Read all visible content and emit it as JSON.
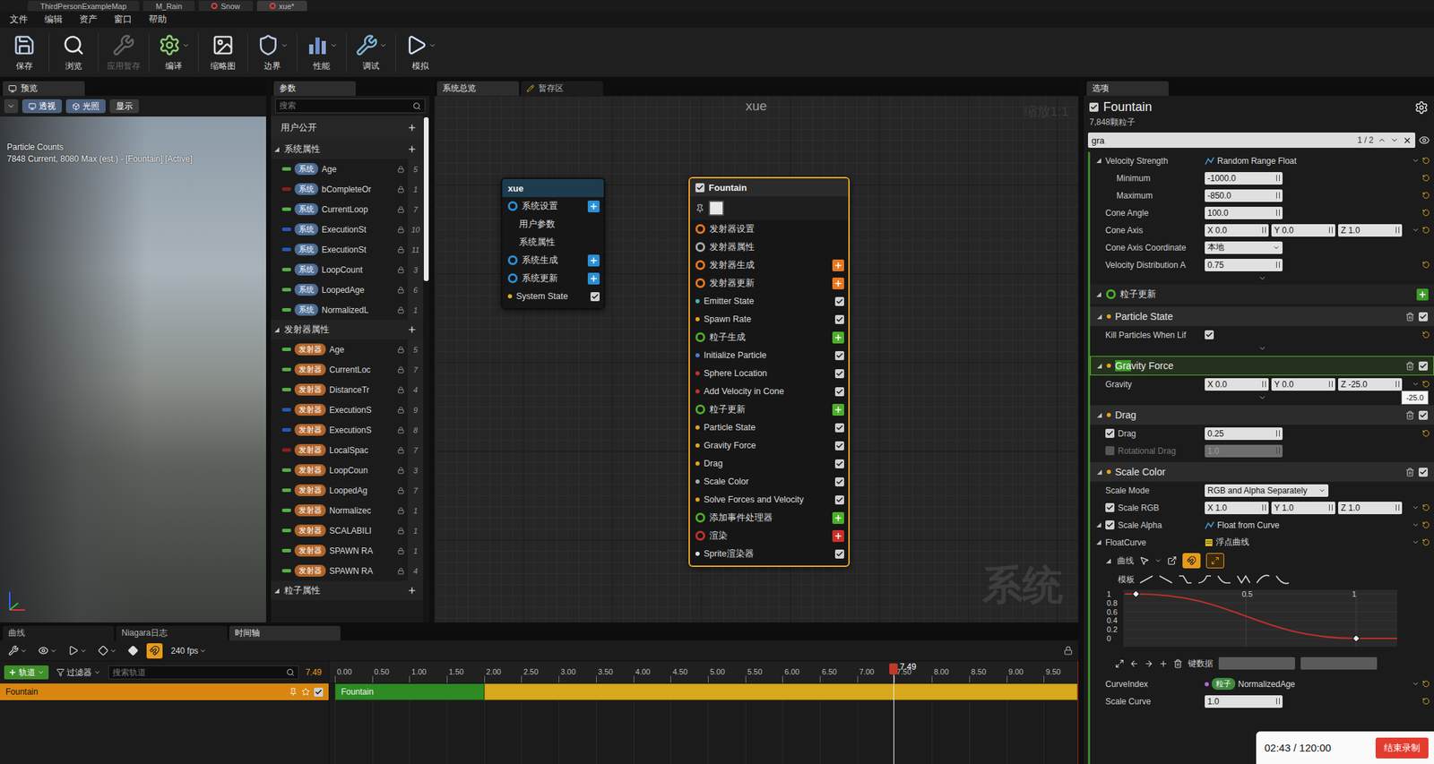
{
  "editor_tabs": [
    {
      "label": "ThirdPersonExampleMap",
      "selected": false
    },
    {
      "label": "M_Rain",
      "selected": false
    },
    {
      "label": "Snow",
      "selected": false
    },
    {
      "label": "xue*",
      "selected": true
    }
  ],
  "menu": [
    "文件",
    "编辑",
    "资产",
    "窗口",
    "帮助"
  ],
  "toolbar": [
    {
      "label": "保存",
      "disabled": false,
      "dropdown": false
    },
    {
      "label": "浏览",
      "disabled": false,
      "dropdown": false
    },
    {
      "label": "应用暂存",
      "disabled": true,
      "dropdown": false
    },
    {
      "label": "编译",
      "disabled": false,
      "dropdown": true
    },
    {
      "label": "缩略图",
      "disabled": false,
      "dropdown": false
    },
    {
      "label": "边界",
      "disabled": false,
      "dropdown": true
    },
    {
      "label": "性能",
      "disabled": false,
      "dropdown": true
    },
    {
      "label": "调试",
      "disabled": false,
      "dropdown": true
    },
    {
      "label": "模拟",
      "disabled": false,
      "dropdown": true
    }
  ],
  "preview": {
    "tab": "预览",
    "buttons": [
      {
        "label": "透视",
        "selected": true
      },
      {
        "label": "光照",
        "selected": true
      },
      {
        "label": "显示",
        "selected": false
      }
    ],
    "overlay_title": "Particle Counts",
    "overlay_text": "7848 Current, 8080 Max (est.) - [Fountain] [Active]"
  },
  "params": {
    "tab": "参数",
    "search_placeholder": "搜索",
    "user_section": "用户公开",
    "sections": [
      {
        "title": "系统属性",
        "expanded": true,
        "tag": "系统",
        "tag_color": "#4d6d95",
        "items": [
          {
            "name": "Age",
            "value": "5",
            "color": "#52b043"
          },
          {
            "name": "bCompleteOr",
            "value": "1",
            "color": "#8a1f1f"
          },
          {
            "name": "CurrentLoop",
            "value": "7",
            "color": "#52b043"
          },
          {
            "name": "ExecutionSt",
            "value": "10",
            "color": "#2458b8"
          },
          {
            "name": "ExecutionSt",
            "value": "11",
            "color": "#2458b8"
          },
          {
            "name": "LoopCount",
            "value": "3",
            "color": "#52b043"
          },
          {
            "name": "LoopedAge",
            "value": "6",
            "color": "#52b043"
          },
          {
            "name": "NormalizedL",
            "value": "1",
            "color": "#52b043"
          }
        ]
      },
      {
        "title": "发射器属性",
        "expanded": true,
        "tag": "发射器",
        "tag_color": "#b0642a",
        "items": [
          {
            "name": "Age",
            "value": "5",
            "color": "#52b043"
          },
          {
            "name": "CurrentLoc",
            "value": "7",
            "color": "#52b043"
          },
          {
            "name": "DistanceTr",
            "value": "4",
            "color": "#52b043"
          },
          {
            "name": "ExecutionS",
            "value": "9",
            "color": "#2458b8"
          },
          {
            "name": "ExecutionS",
            "value": "8",
            "color": "#2458b8"
          },
          {
            "name": "LocalSpac",
            "value": "7",
            "color": "#8a1f1f"
          },
          {
            "name": "LoopCoun",
            "value": "3",
            "color": "#52b043"
          },
          {
            "name": "LoopedAg",
            "value": "7",
            "color": "#52b043"
          },
          {
            "name": "Normalizec",
            "value": "1",
            "color": "#52b043"
          },
          {
            "name": "SCALABILI",
            "value": "1",
            "color": "#52b043"
          },
          {
            "name": "SPAWN RA",
            "value": "1",
            "color": "#52b043"
          },
          {
            "name": "SPAWN RA",
            "value": "4",
            "color": "#52b043"
          }
        ]
      },
      {
        "title": "粒子属性",
        "expanded": true,
        "items": []
      }
    ]
  },
  "graph": {
    "tabs": [
      {
        "label": "系统总览",
        "selected": true
      },
      {
        "label": "暂存区",
        "selected": false
      }
    ],
    "title": "xue",
    "zoom": "缩放1:1",
    "watermark": "系统",
    "nodes": [
      {
        "title": "xue",
        "selected": false,
        "color": "#1d3c4e",
        "rows": [
          {
            "kind": "group",
            "label": "系统设置",
            "color": "#2a8fd6",
            "plus": true
          },
          {
            "kind": "sub",
            "label": "用户参数"
          },
          {
            "kind": "sub",
            "label": "系统属性"
          },
          {
            "kind": "group",
            "label": "系统生成",
            "color": "#2a8fd6",
            "plus": true
          },
          {
            "kind": "group",
            "label": "系统更新",
            "color": "#2a8fd6",
            "plus": true
          },
          {
            "kind": "item",
            "label": "System State",
            "color": "#e0b020",
            "checked": true
          }
        ]
      },
      {
        "title": "Fountain",
        "selected": true,
        "enabled": true,
        "color": "#2b2b2b",
        "rows": [
          {
            "kind": "group",
            "label": "发射器设置",
            "color": "#e8781e",
            "plus": false
          },
          {
            "kind": "group",
            "label": "发射器属性",
            "color": "#aaaaaa",
            "plus": false
          },
          {
            "kind": "group",
            "label": "发射器生成",
            "color": "#e8781e",
            "plus": true
          },
          {
            "kind": "group",
            "label": "发射器更新",
            "color": "#e8781e",
            "plus": true
          },
          {
            "kind": "item",
            "label": "Emitter State",
            "color": "#3fb6b0",
            "checked": true
          },
          {
            "kind": "item",
            "label": "Spawn Rate",
            "color": "#e8a21e",
            "checked": true
          },
          {
            "kind": "group",
            "label": "粒子生成",
            "color": "#4caf2a",
            "plus": true
          },
          {
            "kind": "item",
            "label": "Initialize Particle",
            "color": "#4a7ad6",
            "checked": true
          },
          {
            "kind": "item",
            "label": "Sphere Location",
            "color": "#c8302a",
            "checked": true
          },
          {
            "kind": "item",
            "label": "Add Velocity in Cone",
            "color": "#c8302a",
            "checked": true
          },
          {
            "kind": "group",
            "label": "粒子更新",
            "color": "#4caf2a",
            "plus": true
          },
          {
            "kind": "item",
            "label": "Particle State",
            "color": "#e8a21e",
            "checked": true
          },
          {
            "kind": "item",
            "label": "Gravity Force",
            "color": "#e8a21e",
            "checked": true
          },
          {
            "kind": "item",
            "label": "Drag",
            "color": "#e8a21e",
            "checked": true
          },
          {
            "kind": "item",
            "label": "Scale Color",
            "color": "#aaaaaa",
            "checked": true
          },
          {
            "kind": "item",
            "label": "Solve Forces and Velocity",
            "color": "#e8a21e",
            "checked": true
          },
          {
            "kind": "group",
            "label": "添加事件处理器",
            "color": "#4caf2a",
            "plus": true
          },
          {
            "kind": "group",
            "label": "渲染",
            "color": "#c8302a",
            "plus": true
          },
          {
            "kind": "item",
            "label": "Sprite渲染器",
            "color": "#dddddd",
            "checked": true
          }
        ]
      }
    ]
  },
  "details": {
    "tab": "选项",
    "title": "Fountain",
    "enabled": true,
    "count": "7,848颗粒子",
    "search": {
      "value": "gra",
      "matches": "1 / 2"
    },
    "rows": [
      {
        "kind": "dist",
        "label": "Velocity Strength",
        "value": "Random Range Float",
        "expanded": true
      },
      {
        "kind": "number",
        "label": "Minimum",
        "value": "-1000.0",
        "indent": true
      },
      {
        "kind": "number",
        "label": "Maximum",
        "value": "-850.0",
        "indent": true
      },
      {
        "kind": "number",
        "label": "Cone Angle",
        "value": "100.0"
      },
      {
        "kind": "vector",
        "label": "Cone Axis",
        "fields": [
          {
            "axis": "X",
            "value": "0.0"
          },
          {
            "axis": "Y",
            "value": "0.0"
          },
          {
            "axis": "Z",
            "value": "1.0"
          }
        ]
      },
      {
        "kind": "select",
        "label": "Cone Axis Coordinate",
        "value": "本地"
      },
      {
        "kind": "number",
        "label": "Velocity Distribution A",
        "value": "0.75"
      },
      {
        "kind": "expander"
      },
      {
        "kind": "group",
        "title": "粒子更新"
      },
      {
        "kind": "section",
        "title": "Particle State",
        "enabled": true,
        "selected": false
      },
      {
        "kind": "check",
        "label": "Kill Particles When Lif",
        "checked": true
      },
      {
        "kind": "expander"
      },
      {
        "kind": "section",
        "title_match": "Gra",
        "title": "vity Force",
        "enabled": true,
        "selected": true
      },
      {
        "kind": "vector",
        "label": "Gravity",
        "fields": [
          {
            "axis": "X",
            "value": "0.0"
          },
          {
            "axis": "Y",
            "value": "0.0"
          },
          {
            "axis": "Z",
            "value": "-25.0"
          }
        ],
        "tooltip": "-25.0"
      },
      {
        "kind": "expander"
      },
      {
        "kind": "section",
        "title": "Drag",
        "enabled": true,
        "selected": false
      },
      {
        "kind": "number",
        "label": "Drag",
        "value": "0.25",
        "checked": true,
        "disabled": false
      },
      {
        "kind": "number",
        "label": "Rotational Drag",
        "value": "1.0",
        "checked": false,
        "disabled": true
      },
      {
        "kind": "section",
        "title": "Scale Color",
        "enabled": true,
        "selected": false
      },
      {
        "kind": "select",
        "label": "Scale Mode",
        "value": "RGB and Alpha Separately"
      },
      {
        "kind": "vector",
        "label": "Scale RGB",
        "checked": true,
        "fields": [
          {
            "axis": "X",
            "value": "1.0"
          },
          {
            "axis": "Y",
            "value": "1.0"
          },
          {
            "axis": "Z",
            "value": "1.0"
          }
        ]
      },
      {
        "kind": "dist",
        "label": "Scale Alpha",
        "value": "Float from Curve",
        "checked": true,
        "expanded": true
      },
      {
        "kind": "asset",
        "label": "FloatCurve",
        "value": "浮点曲线",
        "expanded": true
      },
      {
        "kind": "curve",
        "label": "曲线",
        "expanded": true,
        "template_label": "模板",
        "y_ticks": [
          "1",
          "0.8",
          "0.6",
          "0.4",
          "0.2",
          "0"
        ],
        "x_ticks": [
          "0.5",
          "1"
        ],
        "keys": [
          {
            "t": 0,
            "v": 1
          },
          {
            "t": 1,
            "v": 0
          }
        ],
        "key_label": "键数据"
      },
      {
        "kind": "param",
        "label": "CurveIndex",
        "tag": "粒子",
        "value": "NormalizedAge"
      },
      {
        "kind": "number",
        "label": "Scale Curve",
        "value": "1.0"
      }
    ]
  },
  "recording": {
    "time": "02:43 / 120:00",
    "button": "结束录制"
  },
  "timeline": {
    "tabs": [
      {
        "label": "曲线",
        "selected": false
      },
      {
        "label": "Niagara日志",
        "selected": false
      },
      {
        "label": "时间轴",
        "selected": true
      }
    ],
    "fps": "240 fps",
    "add_track": "轨道",
    "filter": "过滤器",
    "search_placeholder": "搜索轨道",
    "current_time": "7.49",
    "ticks": [
      "0.00",
      "0.50",
      "1.00",
      "1.50",
      "2.00",
      "2.50",
      "3.00",
      "3.50",
      "4.00",
      "4.50",
      "5.00",
      "5.50",
      "6.00",
      "6.50",
      "7.00",
      "7.50",
      "8.00",
      "8.50",
      "9.00",
      "9.50"
    ],
    "playhead": 7.49,
    "playhead_label": "7.49",
    "tracks": [
      {
        "name": "Fountain",
        "checked": true,
        "segments": [
          {
            "start": 0,
            "end": 2,
            "color": "#2e8b24",
            "label": "Fountain"
          },
          {
            "start": 2,
            "end": 9.95,
            "color": "#d7a81c",
            "label": ""
          }
        ]
      }
    ]
  }
}
